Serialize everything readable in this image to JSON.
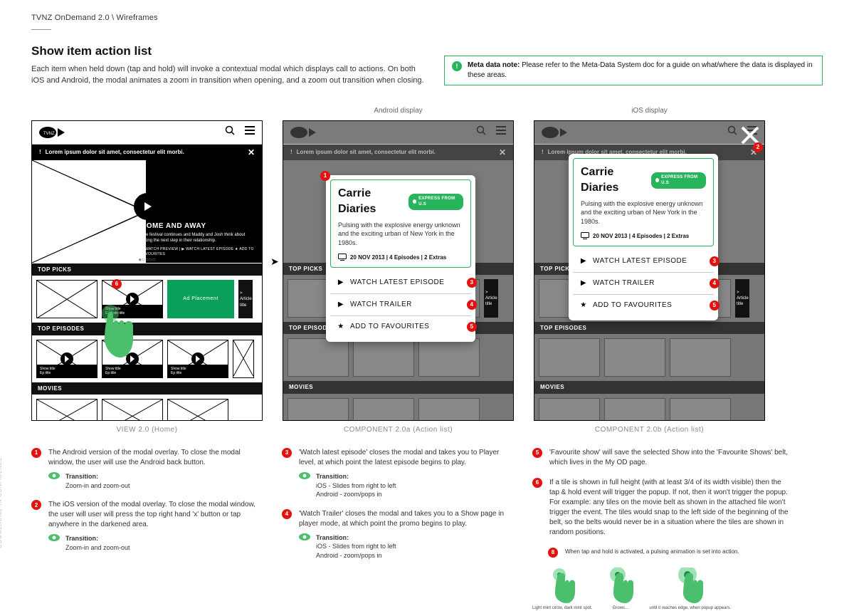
{
  "breadcrumb": "TVNZ OnDemand 2.0 \\ Wireframes",
  "title": "Show item action list",
  "intro": "Each item when held down (tap and hold) will invoke a contextual modal which displays call to actions. On both iOS and Android, the modal animates a zoom in transition when opening, and a zoom out transition when closing.",
  "meta_note": {
    "label": "Meta data note:",
    "text": "Please refer to the Meta-Data System doc for a guide on what/where the data is displayed in these areas."
  },
  "labels": {
    "android": "Android display",
    "ios": "iOS display"
  },
  "captions": {
    "home": "VIEW 2.0 (Home)",
    "android": "COMPONENT 2.0a (Action list)",
    "ios": "COMPONENT 2.0b (Action list)"
  },
  "notice": "Lorem ipsum dolor sit amet, consectetur elit morbi.",
  "hero": {
    "title": "HOME AND AWAY",
    "sub": "The festival continues and Maddy and Josh think about taking the next step in their relationship.",
    "actions": "✦ WATCH PREVIEW   |   ▶ WATCH LATEST EPISODE\n★ ADD TO FAVOURITES"
  },
  "belts": {
    "top_picks": "TOP PICKS",
    "top_episodes": "TOP EPISODES",
    "movies": "MOVIES",
    "tile_line1": "Show title",
    "tile_line2": "Episode title",
    "tile_line2_short": "Ep title",
    "ad": "Ad Placement",
    "article": "> Article title"
  },
  "modal": {
    "title": "Carrie Diaries",
    "pill": "EXPRESS FROM U.S",
    "body": "Pulsing with the explosive energy unknown and the exciting urban of New York in the 1980s.",
    "meta": "20 NOV 2013 | 4 Episodes | 2 Extras",
    "actions": {
      "watch_latest": "WATCH LATEST EPISODE",
      "watch_trailer": "WATCH TRAILER",
      "add_fav": "ADD TO FAVOURITES"
    }
  },
  "annotations": {
    "1": "The Android version of the modal overlay. To close the modal window, the user will use the Android back button.",
    "2": "The iOS version of the modal overlay. To close the modal window, the user will user will press the top right hand 'x' button or tap anywhere in the darkened area.",
    "3": "'Watch latest episode' closes the modal and takes you to Player level, at which point the latest episode begins to play.",
    "4": "'Watch Trailer' closes the modal and takes you to a Show page in player mode, at which point the promo begins to play.",
    "5": "'Favourite show' will save the selected Show into the 'Favourite Shows' belt, which lives in the My OD page.",
    "6": "If a tile is shown in full height (with at least 3/4 of its width visible) then the tap & hold event will trigger the popup. If not, then it won't trigger the popup. For example: any tiles on the movie belt as shown in the attached file won't trigger the event. The tiles would snap to the left side of the beginning of the belt, so the belts would never be in a situation where the tiles are shown in random positions.",
    "8": "When tap and hold is activated, a pulsing animation is set into action.",
    "trans_label": "Transition:",
    "t_zoom": "Zoom-in and zoom-out",
    "t_ios": "iOS - Slides from right to left",
    "t_android": "Android - zoom/pops in",
    "tapseq": {
      "a": "Light mint circle, dark mint spot.",
      "b": "Grows…",
      "c": "until it reaches edge, when popup appears."
    }
  },
  "side": "COMMERCIAL IN CONFIDENCE"
}
